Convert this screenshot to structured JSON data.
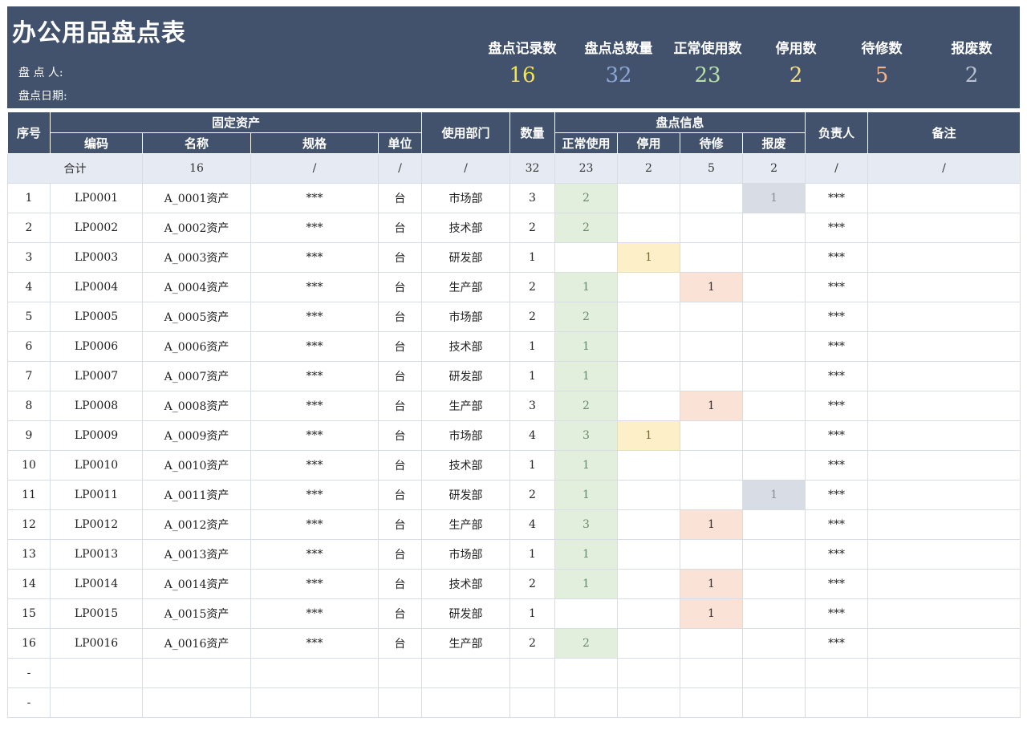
{
  "header": {
    "title": "办公用品盘点表",
    "checker_label": "盘   点   人:",
    "date_label": "盘点日期:",
    "stats": [
      {
        "label": "盘点记录数",
        "value": "16",
        "color": "#f5e642"
      },
      {
        "label": "盘点总数量",
        "value": "32",
        "color": "#8ea6d4"
      },
      {
        "label": "正常使用数",
        "value": "23",
        "color": "#b8e0a8"
      },
      {
        "label": "停用数",
        "value": "2",
        "color": "#f7e08a"
      },
      {
        "label": "待修数",
        "value": "5",
        "color": "#f2b48c"
      },
      {
        "label": "报废数",
        "value": "2",
        "color": "#b8c2d0"
      }
    ]
  },
  "columns": {
    "seq": "序号",
    "fixed_asset": "固定资产",
    "code": "编码",
    "name": "名称",
    "spec": "规格",
    "unit": "单位",
    "dept": "使用部门",
    "qty": "数量",
    "check_info": "盘点信息",
    "normal": "正常使用",
    "stop": "停用",
    "repair": "待修",
    "scrap": "报废",
    "owner": "负责人",
    "remark": "备注"
  },
  "summary": {
    "label": "合计",
    "name": "16",
    "spec": "/",
    "unit": "/",
    "dept": "/",
    "qty": "32",
    "normal": "23",
    "stop": "2",
    "repair": "5",
    "scrap": "2",
    "owner": "/",
    "remark": "/"
  },
  "rows": [
    {
      "seq": "1",
      "code": "LP0001",
      "name": "A_0001资产",
      "spec": "***",
      "unit": "台",
      "dept": "市场部",
      "qty": "3",
      "normal": "2",
      "stop": "",
      "repair": "",
      "scrap": "1",
      "owner": "***",
      "remark": ""
    },
    {
      "seq": "2",
      "code": "LP0002",
      "name": "A_0002资产",
      "spec": "***",
      "unit": "台",
      "dept": "技术部",
      "qty": "2",
      "normal": "2",
      "stop": "",
      "repair": "",
      "scrap": "",
      "owner": "***",
      "remark": ""
    },
    {
      "seq": "3",
      "code": "LP0003",
      "name": "A_0003资产",
      "spec": "***",
      "unit": "台",
      "dept": "研发部",
      "qty": "1",
      "normal": "",
      "stop": "1",
      "repair": "",
      "scrap": "",
      "owner": "***",
      "remark": ""
    },
    {
      "seq": "4",
      "code": "LP0004",
      "name": "A_0004资产",
      "spec": "***",
      "unit": "台",
      "dept": "生产部",
      "qty": "2",
      "normal": "1",
      "stop": "",
      "repair": "1",
      "scrap": "",
      "owner": "***",
      "remark": ""
    },
    {
      "seq": "5",
      "code": "LP0005",
      "name": "A_0005资产",
      "spec": "***",
      "unit": "台",
      "dept": "市场部",
      "qty": "2",
      "normal": "2",
      "stop": "",
      "repair": "",
      "scrap": "",
      "owner": "***",
      "remark": ""
    },
    {
      "seq": "6",
      "code": "LP0006",
      "name": "A_0006资产",
      "spec": "***",
      "unit": "台",
      "dept": "技术部",
      "qty": "1",
      "normal": "1",
      "stop": "",
      "repair": "",
      "scrap": "",
      "owner": "***",
      "remark": ""
    },
    {
      "seq": "7",
      "code": "LP0007",
      "name": "A_0007资产",
      "spec": "***",
      "unit": "台",
      "dept": "研发部",
      "qty": "1",
      "normal": "1",
      "stop": "",
      "repair": "",
      "scrap": "",
      "owner": "***",
      "remark": ""
    },
    {
      "seq": "8",
      "code": "LP0008",
      "name": "A_0008资产",
      "spec": "***",
      "unit": "台",
      "dept": "生产部",
      "qty": "3",
      "normal": "2",
      "stop": "",
      "repair": "1",
      "scrap": "",
      "owner": "***",
      "remark": ""
    },
    {
      "seq": "9",
      "code": "LP0009",
      "name": "A_0009资产",
      "spec": "***",
      "unit": "台",
      "dept": "市场部",
      "qty": "4",
      "normal": "3",
      "stop": "1",
      "repair": "",
      "scrap": "",
      "owner": "***",
      "remark": ""
    },
    {
      "seq": "10",
      "code": "LP0010",
      "name": "A_0010资产",
      "spec": "***",
      "unit": "台",
      "dept": "技术部",
      "qty": "1",
      "normal": "1",
      "stop": "",
      "repair": "",
      "scrap": "",
      "owner": "***",
      "remark": ""
    },
    {
      "seq": "11",
      "code": "LP0011",
      "name": "A_0011资产",
      "spec": "***",
      "unit": "台",
      "dept": "研发部",
      "qty": "2",
      "normal": "1",
      "stop": "",
      "repair": "",
      "scrap": "1",
      "owner": "***",
      "remark": ""
    },
    {
      "seq": "12",
      "code": "LP0012",
      "name": "A_0012资产",
      "spec": "***",
      "unit": "台",
      "dept": "生产部",
      "qty": "4",
      "normal": "3",
      "stop": "",
      "repair": "1",
      "scrap": "",
      "owner": "***",
      "remark": ""
    },
    {
      "seq": "13",
      "code": "LP0013",
      "name": "A_0013资产",
      "spec": "***",
      "unit": "台",
      "dept": "市场部",
      "qty": "1",
      "normal": "1",
      "stop": "",
      "repair": "",
      "scrap": "",
      "owner": "***",
      "remark": ""
    },
    {
      "seq": "14",
      "code": "LP0014",
      "name": "A_0014资产",
      "spec": "***",
      "unit": "台",
      "dept": "技术部",
      "qty": "2",
      "normal": "1",
      "stop": "",
      "repair": "1",
      "scrap": "",
      "owner": "***",
      "remark": ""
    },
    {
      "seq": "15",
      "code": "LP0015",
      "name": "A_0015资产",
      "spec": "***",
      "unit": "台",
      "dept": "研发部",
      "qty": "1",
      "normal": "",
      "stop": "",
      "repair": "1",
      "scrap": "",
      "owner": "***",
      "remark": ""
    },
    {
      "seq": "16",
      "code": "LP0016",
      "name": "A_0016资产",
      "spec": "***",
      "unit": "台",
      "dept": "生产部",
      "qty": "2",
      "normal": "2",
      "stop": "",
      "repair": "",
      "scrap": "",
      "owner": "***",
      "remark": ""
    }
  ],
  "blank_rows": [
    {
      "seq": "-"
    },
    {
      "seq": "-"
    }
  ]
}
